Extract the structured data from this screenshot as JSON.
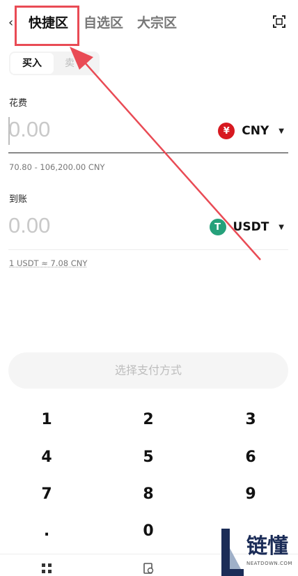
{
  "header": {
    "back_glyph": "‹",
    "tabs": [
      {
        "label": "快捷区",
        "active": true
      },
      {
        "label": "自选区",
        "active": false
      },
      {
        "label": "大宗区",
        "active": false
      }
    ]
  },
  "toggle": {
    "buy": "买入",
    "sell": "卖"
  },
  "spend": {
    "label": "花费",
    "amount_placeholder": "0.00",
    "currency": "CNY",
    "currency_symbol": "¥",
    "range_hint": "70.80 - 106,200.00 CNY"
  },
  "receive": {
    "label": "到账",
    "amount_placeholder": "0.00",
    "currency": "USDT",
    "currency_symbol": "T",
    "rate_hint": "1 USDT ≈ 7.08 CNY"
  },
  "pay_button": "选择支付方式",
  "keypad": [
    "1",
    "2",
    "3",
    "4",
    "5",
    "6",
    "7",
    "8",
    "9",
    ".",
    "0"
  ],
  "watermark": {
    "chars": "链懂",
    "sub": "NEATDOWN.COM"
  },
  "colors": {
    "annotation": "#e94b55",
    "cny": "#d71920",
    "usdt": "#26a17b"
  }
}
